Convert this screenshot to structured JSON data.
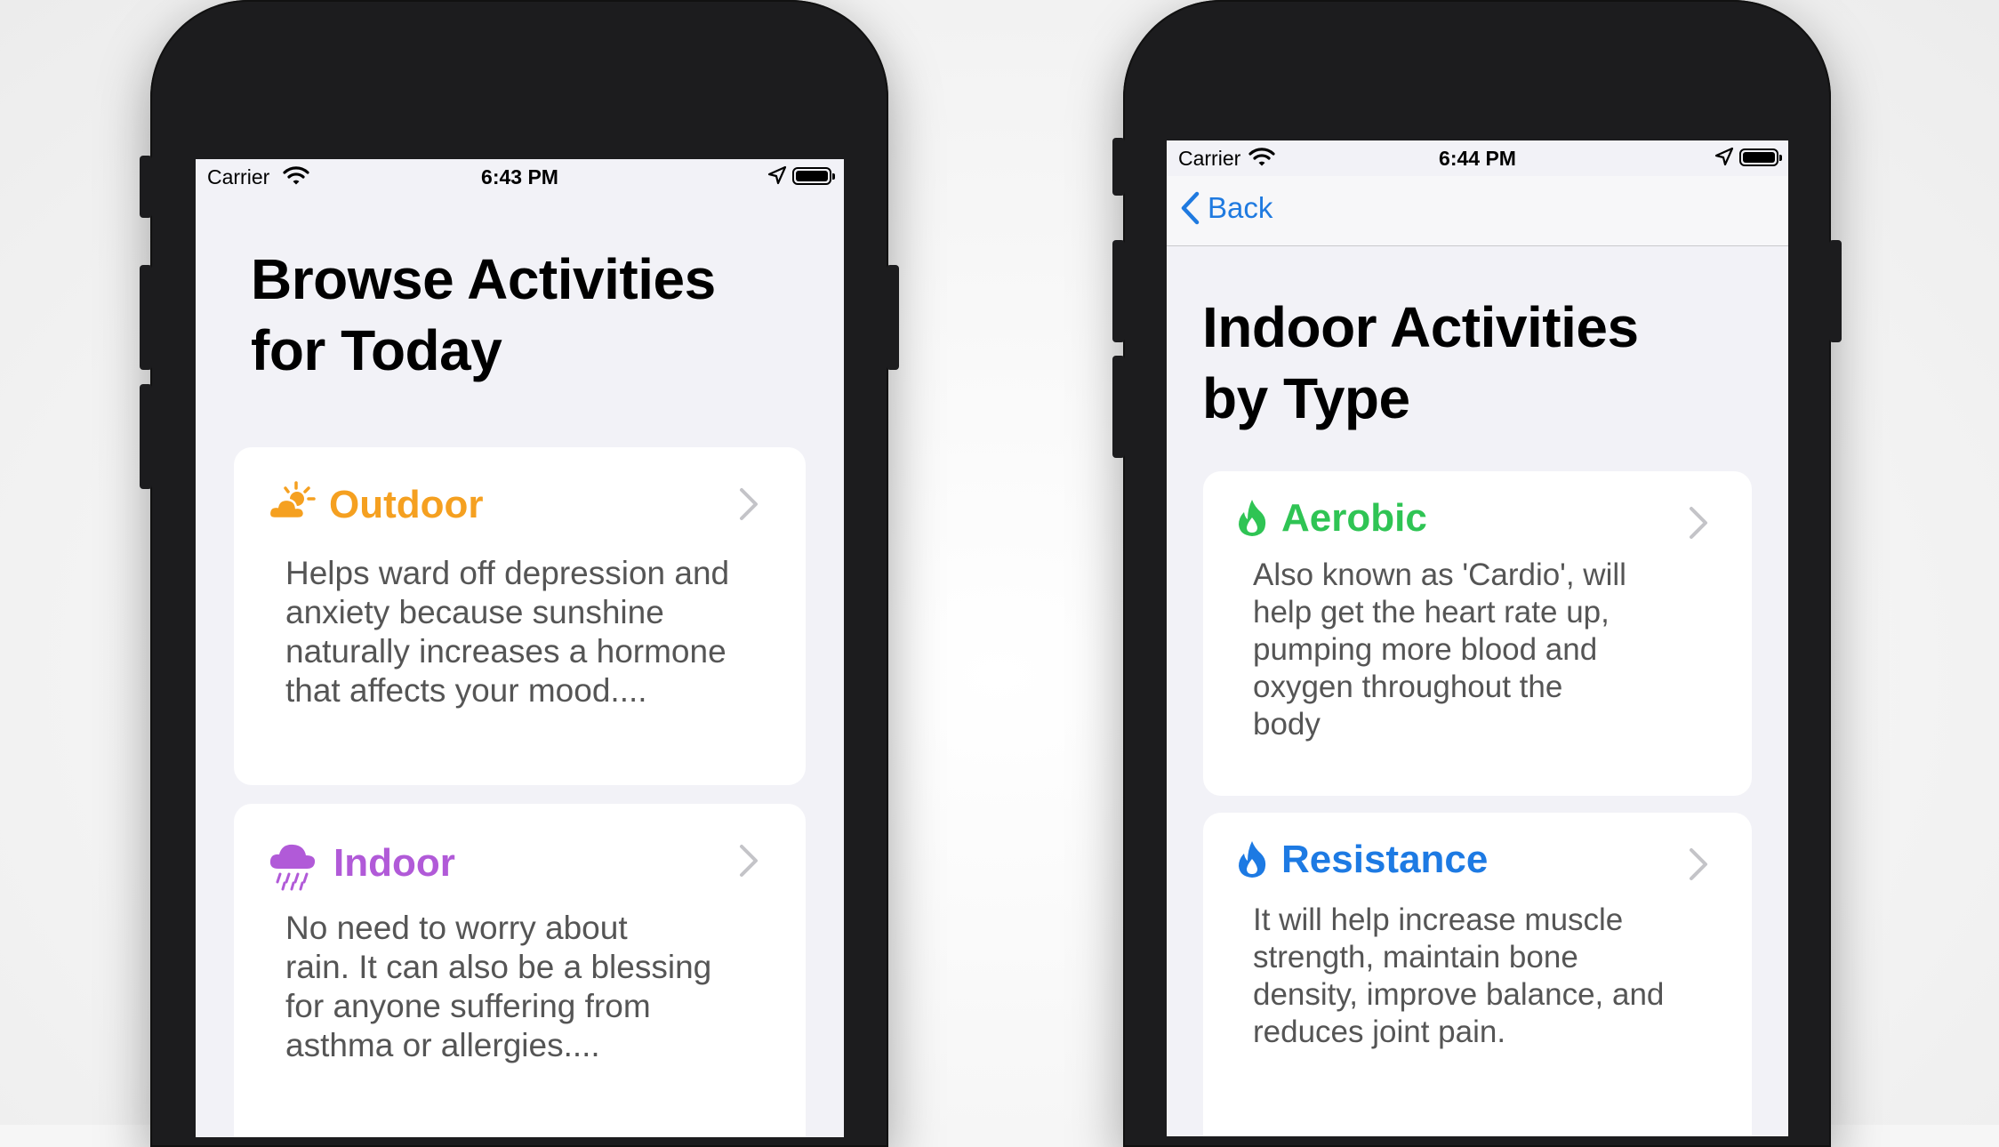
{
  "colors": {
    "outdoor": "#f5a020",
    "indoor": "#b15ad8",
    "aerobic": "#2fc454",
    "resistance": "#1d7ae3",
    "link": "#1f7ae0"
  },
  "left_screen": {
    "status": {
      "carrier": "Carrier",
      "time": "6:43 PM"
    },
    "title_line1": "Browse Activities",
    "title_line2": "for Today",
    "cards": [
      {
        "icon": "sun-cloud-icon",
        "title": "Outdoor",
        "lines": [
          "Helps ward off depression and",
          "anxiety because sunshine",
          "naturally increases a hormone",
          "that affects your mood...."
        ]
      },
      {
        "icon": "rain-cloud-icon",
        "title": "Indoor",
        "lines": [
          "No need to worry about",
          "rain. It can also be a blessing",
          "for anyone suffering from",
          "asthma or allergies...."
        ]
      }
    ]
  },
  "right_screen": {
    "status": {
      "carrier": "Carrier",
      "time": "6:44 PM"
    },
    "back_label": "Back",
    "title_line1": "Indoor Activities",
    "title_line2": "by Type",
    "cards": [
      {
        "icon": "flame-icon",
        "title": "Aerobic",
        "lines": [
          "Also known as 'Cardio', will",
          "help get the heart rate up,",
          "pumping more blood and",
          "oxygen throughout the",
          "body"
        ]
      },
      {
        "icon": "flame-icon",
        "title": "Resistance",
        "lines": [
          "It will help increase muscle",
          "strength, maintain bone",
          "density, improve balance, and",
          "reduces joint pain."
        ]
      }
    ]
  }
}
